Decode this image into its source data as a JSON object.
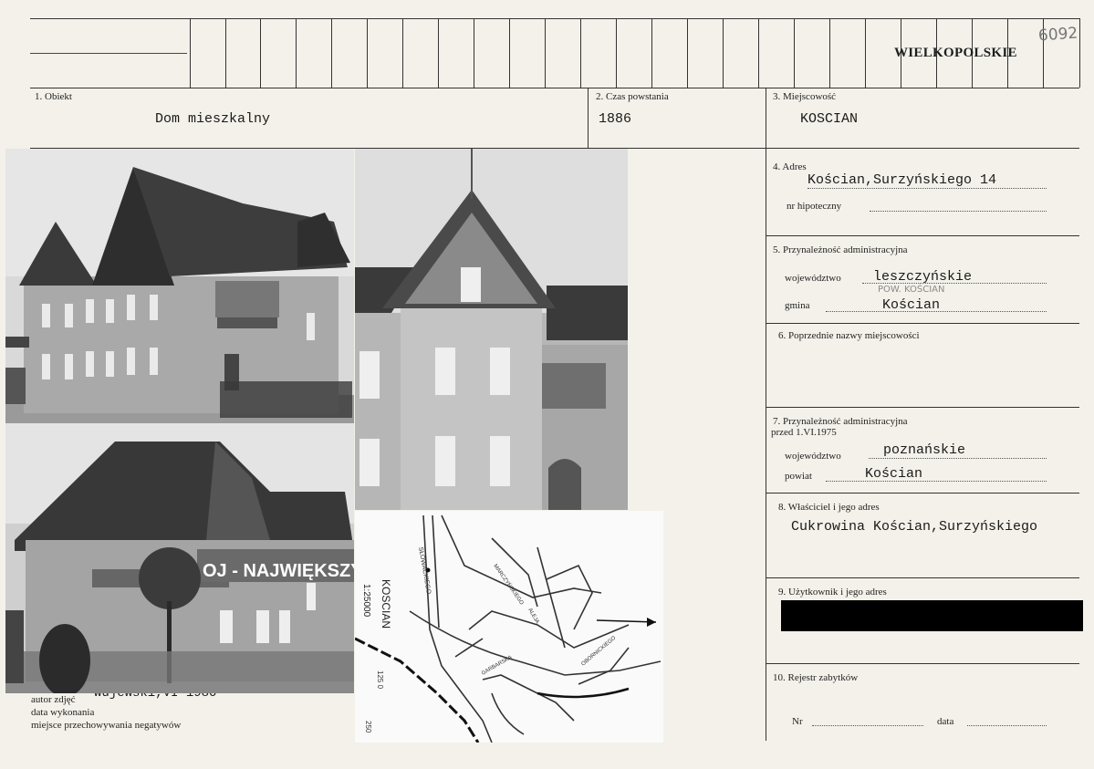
{
  "header": {
    "region": "WIELKOPOLSKIE",
    "card_number": "6092"
  },
  "fields": {
    "obiekt": {
      "label": "1. Obiekt",
      "value": "Dom mieszkalny"
    },
    "czas": {
      "label": "2. Czas powstania",
      "value": "1886"
    },
    "miejscowosc": {
      "label": "3. Miejscowość",
      "value": "KOSCIAN"
    },
    "adres": {
      "label": "4. Adres",
      "value": "Kościan,Surzyńskiego 14",
      "hipoteczny_label": "nr hipoteczny"
    },
    "przynaleznosc": {
      "label": "5. Przynależność administracyjna",
      "woj_label": "województwo",
      "woj_value": "leszczyńskie",
      "pow_note": "POW. KOŚCIAN",
      "gmina_label": "gmina",
      "gmina_value": "Kościan"
    },
    "poprzednie": {
      "label": "6. Poprzednie nazwy miejscowości"
    },
    "przed1975": {
      "label": "7. Przynależność administracyjna",
      "label2": "przed 1.VI.1975",
      "woj_label": "województwo",
      "woj_value": "poznańskie",
      "powiat_label": "powiat",
      "powiat_value": "Kościan"
    },
    "wlasciciel": {
      "label": "8. Właściciel i jego adres",
      "value": "Cukrowina Kościan,Surzyńskiego"
    },
    "uzytkownik": {
      "label": "9. Użytkownik i jego adres"
    },
    "rejestr": {
      "label": "10. Rejestr zabytków",
      "nr_label": "Nr",
      "data_label": "data"
    }
  },
  "footer": {
    "autor": "autor zdjęć",
    "autor_value": "Wujewski,VI 1980",
    "data_wykonania": "data wykonania",
    "miejsce": "miejsce przechowywania negatywów"
  },
  "photos": {
    "banner_text": "OJ - NAJWIĘKSZYM"
  },
  "map": {
    "scale": "1:25000",
    "town": "KOSCIAN",
    "streets": [
      "SURZYŃSKIEGO",
      "SŁOWACKIEGO",
      "ALEJA",
      "GARBARSKA",
      "OBORNICKIEGO",
      "MARCZYŃSKIEGO"
    ],
    "marker": "125 0",
    "marker2": "250"
  }
}
